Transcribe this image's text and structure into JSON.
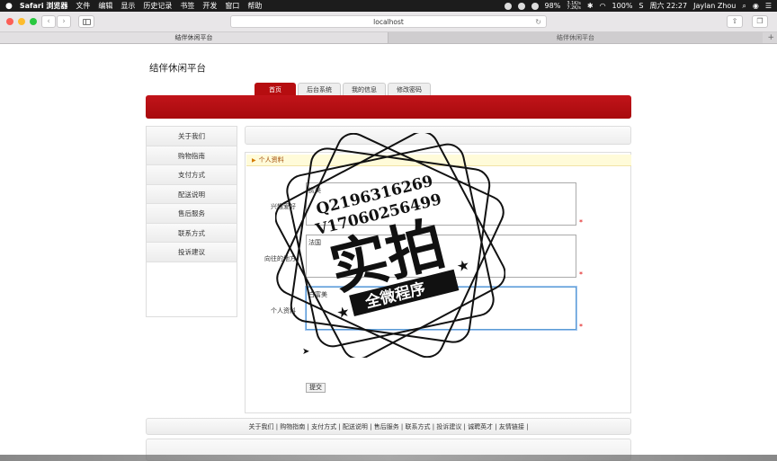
{
  "menubar": {
    "apple": "",
    "app": "Safari 浏览器",
    "items": [
      "文件",
      "编辑",
      "显示",
      "历史记录",
      "书签",
      "开发",
      "窗口",
      "帮助"
    ],
    "battery_pct": "98%",
    "net_up": "3.1K/s",
    "net_down": "7.2K/s",
    "volume_pct": "100%",
    "clock": "周六 22:27",
    "user": "Jaylan Zhou"
  },
  "browser": {
    "url": "localhost",
    "tabs": [
      "结伴休闲平台",
      "结伴休闲平台"
    ]
  },
  "site": {
    "title": "结伴休闲平台",
    "nav": [
      "首页",
      "后台系统",
      "我的信息",
      "修改密码"
    ],
    "sidebar": [
      "关于我们",
      "购物指南",
      "支付方式",
      "配送说明",
      "售后服务",
      "联系方式",
      "投诉建议"
    ],
    "section_title": "个人资料",
    "fields": [
      {
        "label": "兴趣爱好",
        "value": "赏美"
      },
      {
        "label": "向往的地方",
        "value": "法国"
      },
      {
        "label": "个人资料",
        "value": "白富美"
      }
    ],
    "submit": "提交",
    "footer_links": "关于我们 | 购物指南 | 支付方式 | 配送说明 | 售后服务 | 联系方式 | 投诉建议 | 诚聘英才 | 友情链接 |"
  },
  "watermark": {
    "line1": "Q2196316269",
    "line2": "V17060256499",
    "big": "实拍",
    "ribbon": "全微程序"
  },
  "colors": {
    "brand_red": "#b60d10",
    "highlight": "#fffbd9"
  }
}
